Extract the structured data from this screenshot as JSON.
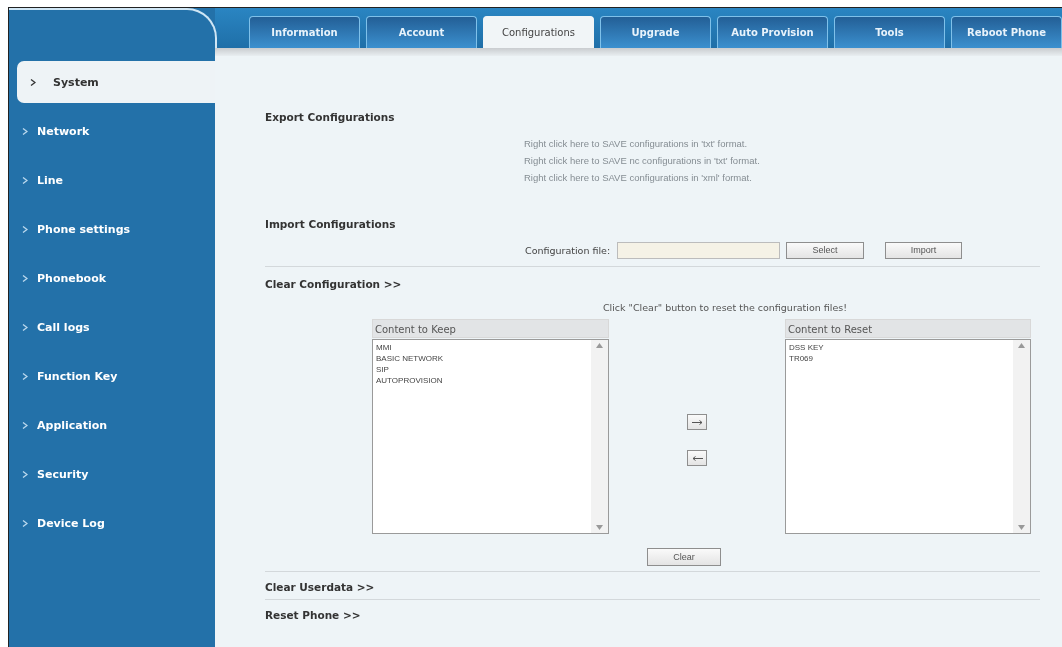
{
  "tabs": [
    {
      "label": "Information",
      "selected": false
    },
    {
      "label": "Account",
      "selected": false
    },
    {
      "label": "Configurations",
      "selected": true
    },
    {
      "label": "Upgrade",
      "selected": false
    },
    {
      "label": "Auto Provision",
      "selected": false
    },
    {
      "label": "Tools",
      "selected": false
    },
    {
      "label": "Reboot Phone",
      "selected": false
    }
  ],
  "sidebar": {
    "items": [
      {
        "label": "System",
        "selected": true
      },
      {
        "label": "Network",
        "selected": false
      },
      {
        "label": "Line",
        "selected": false
      },
      {
        "label": "Phone settings",
        "selected": false
      },
      {
        "label": "Phonebook",
        "selected": false
      },
      {
        "label": "Call logs",
        "selected": false
      },
      {
        "label": "Function Key",
        "selected": false
      },
      {
        "label": "Application",
        "selected": false
      },
      {
        "label": "Security",
        "selected": false
      },
      {
        "label": "Device Log",
        "selected": false
      }
    ]
  },
  "export": {
    "title": "Export Configurations",
    "links": [
      "Right click here to SAVE configurations in 'txt' format.",
      "Right click here to SAVE nc configurations in 'txt' format.",
      "Right click here to SAVE configurations in 'xml' format."
    ]
  },
  "import": {
    "title": "Import Configurations",
    "file_label": "Configuration file:",
    "select_button": "Select",
    "import_button": "Import"
  },
  "clear_configuration": {
    "title": "Clear Configuration >>",
    "instruction": "Click \"Clear\" button to reset the configuration files!",
    "keep": {
      "header": "Content to Keep",
      "items": [
        "MMI",
        "BASIC NETWORK",
        "SIP",
        "AUTOPROVISION"
      ]
    },
    "reset": {
      "header": "Content to Reset",
      "items": [
        "DSS KEY",
        "TR069"
      ]
    },
    "clear_button": "Clear"
  },
  "collapsed_sections": [
    "Clear Userdata >>",
    "Reset Phone >>"
  ]
}
